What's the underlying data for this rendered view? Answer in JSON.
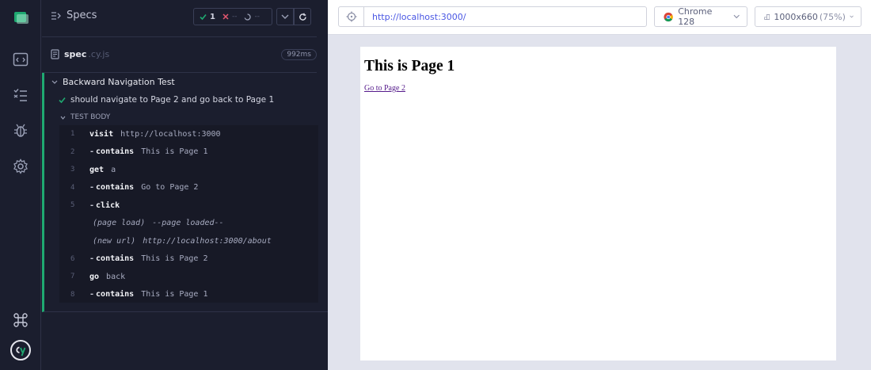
{
  "header": {
    "specs_label": "Specs",
    "passed": "1",
    "failed": "--",
    "pending": "--"
  },
  "spec": {
    "name": "spec",
    "ext": ".cy.js",
    "duration": "992ms"
  },
  "suite": {
    "title": "Backward Navigation Test",
    "test": "should navigate to Page 2 and go back to Page 1",
    "body_label": "TEST BODY"
  },
  "commands": [
    {
      "num": "1",
      "name": "visit",
      "message": "http://localhost:3000"
    },
    {
      "num": "2",
      "name": "contains",
      "message": "This is Page 1"
    },
    {
      "num": "3",
      "name": "get",
      "message": "a"
    },
    {
      "num": "4",
      "name": "contains",
      "message": "Go to Page 2"
    },
    {
      "num": "5",
      "name": "click",
      "message": ""
    },
    {
      "num": "",
      "name": "(page load)",
      "message": "--page loaded--"
    },
    {
      "num": "",
      "name": "(new url)",
      "message": "http://localhost:3000/about"
    },
    {
      "num": "6",
      "name": "contains",
      "message": "This is Page 2"
    },
    {
      "num": "7",
      "name": "go",
      "message": "back"
    },
    {
      "num": "8",
      "name": "contains",
      "message": "This is Page 1"
    }
  ],
  "aut": {
    "url": "http://localhost:3000/",
    "browser": "Chrome 128",
    "viewport": "1000x660",
    "scale": "(75%)",
    "page_heading": "This is Page 1",
    "page_link": "Go to Page 2"
  },
  "colors": {
    "pass": "#1fa971",
    "fail": "#e45770",
    "link": "#4956e3"
  }
}
